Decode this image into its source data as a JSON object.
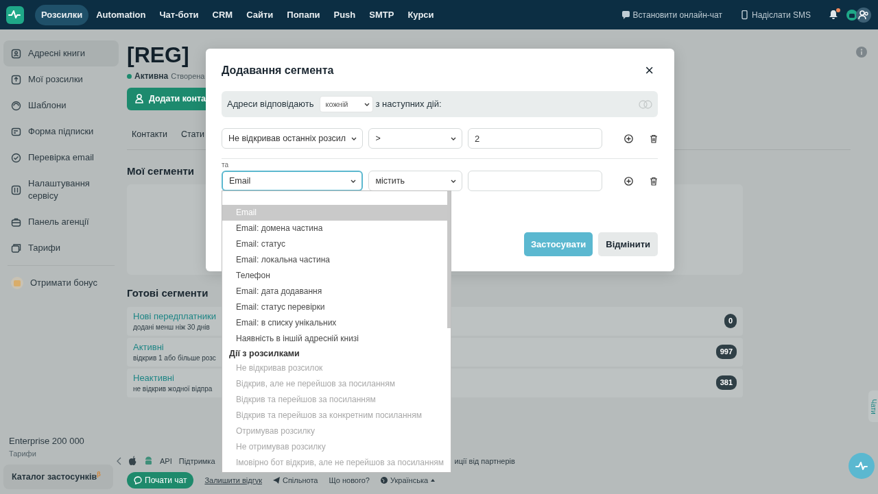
{
  "navbar": {
    "items": [
      {
        "label": "Розсилки",
        "selected": true
      },
      {
        "label": "Automation",
        "selected": false
      },
      {
        "label": "Чат-боти",
        "selected": false
      },
      {
        "label": "CRM",
        "selected": false
      },
      {
        "label": "Сайти",
        "selected": false
      },
      {
        "label": "Попапи",
        "selected": false
      },
      {
        "label": "Push",
        "selected": false
      },
      {
        "label": "SMTP",
        "selected": false
      },
      {
        "label": "Курси",
        "selected": false
      }
    ],
    "actions": [
      {
        "label": "Встановити онлайн-чат"
      },
      {
        "label": "Надіслати SMS"
      }
    ],
    "notifications": {
      "unread": true
    }
  },
  "sidebar": {
    "items": [
      {
        "label": "Адресні книги",
        "selected": true
      },
      {
        "label": "Мої розсилки",
        "selected": false
      },
      {
        "label": "Шаблони",
        "selected": false
      },
      {
        "label": "Форма підписки",
        "selected": false
      },
      {
        "label": "Перевірка email",
        "selected": false
      },
      {
        "label": "Налаштування сервісу",
        "selected": false
      },
      {
        "label": "Панель агенції",
        "selected": false
      },
      {
        "label": "Тарифи",
        "selected": false
      }
    ],
    "bonus": "Отримати бонус",
    "plan": {
      "name": "Enterprise 200 000",
      "link": "Тарифи"
    },
    "catalog": {
      "label": "Каталог застосунків",
      "beta": "β"
    }
  },
  "page": {
    "title": "[REG]",
    "status": "Активна",
    "created": "Створена",
    "add_button": "Додати конта",
    "tabs": [
      {
        "label": "Контакти"
      },
      {
        "label": "Стати"
      }
    ],
    "my_segments": "Мої сегменти",
    "ready_segments": "Готові сегменти",
    "segments": [
      {
        "title": "Нові передплатники",
        "description": "додані менш ніж 30 днів",
        "count": "0"
      },
      {
        "title": "Активні",
        "description": "відкрив 1 або більше розс",
        "count": "997"
      },
      {
        "title": "Неактивні",
        "description": "не відкрив жодної відпра",
        "count": "381"
      }
    ]
  },
  "footer": {
    "links": [
      "API",
      "Підтримка"
    ],
    "partners": "иції від партнерів",
    "chat_button": "Почати чат",
    "feedback": "Залишити відгук",
    "community": "Спільнота",
    "whats_new": "Що нового?",
    "language": "Українська"
  },
  "chats_tab": "Чати",
  "modal": {
    "title": "Додавання сегмента",
    "close": "×",
    "match": {
      "prefix": "Адреси відповідають",
      "mode": "кожній",
      "suffix": "з наступних дій:"
    },
    "conditions": [
      {
        "field": "Не відкривав останніх розсил",
        "operator": ">",
        "value": "2",
        "focused": false
      },
      {
        "joiner": "та",
        "field": "Email",
        "operator": "містить",
        "focused": true
      }
    ],
    "apply": "Застосувати",
    "cancel": "Відмінити",
    "dropdown": {
      "items": [
        {
          "kind": "option",
          "label": "Email",
          "selected": true,
          "disabled": false
        },
        {
          "kind": "option",
          "label": "Email: домена частина",
          "selected": false,
          "disabled": false
        },
        {
          "kind": "option",
          "label": "Email: статус",
          "selected": false,
          "disabled": false
        },
        {
          "kind": "option",
          "label": "Email: локальна частина",
          "selected": false,
          "disabled": false
        },
        {
          "kind": "option",
          "label": "Телефон",
          "selected": false,
          "disabled": false
        },
        {
          "kind": "option",
          "label": "Email: дата додавання",
          "selected": false,
          "disabled": false
        },
        {
          "kind": "option",
          "label": "Email: статус перевірки",
          "selected": false,
          "disabled": false
        },
        {
          "kind": "option",
          "label": "Email: в списку унікальних",
          "selected": false,
          "disabled": false
        },
        {
          "kind": "option",
          "label": "Наявність в іншій адресній книзі",
          "selected": false,
          "disabled": false
        },
        {
          "kind": "group",
          "label": "Дії з розсилками"
        },
        {
          "kind": "option",
          "label": "Не відкривав розсилок",
          "selected": false,
          "disabled": true
        },
        {
          "kind": "option",
          "label": "Відкрив, але не перейшов за посиланням",
          "selected": false,
          "disabled": true
        },
        {
          "kind": "option",
          "label": "Відкрив та перейшов за посиланням",
          "selected": false,
          "disabled": true
        },
        {
          "kind": "option",
          "label": "Відкрив та перейшов за конкретним посиланням",
          "selected": false,
          "disabled": true
        },
        {
          "kind": "option",
          "label": "Отримував розсилку",
          "selected": false,
          "disabled": true
        },
        {
          "kind": "option",
          "label": "Не отримував розсилку",
          "selected": false,
          "disabled": true
        },
        {
          "kind": "option",
          "label": "Імовірно бот відкрив, але не перейшов за посиланням",
          "selected": false,
          "disabled": true
        }
      ]
    }
  }
}
